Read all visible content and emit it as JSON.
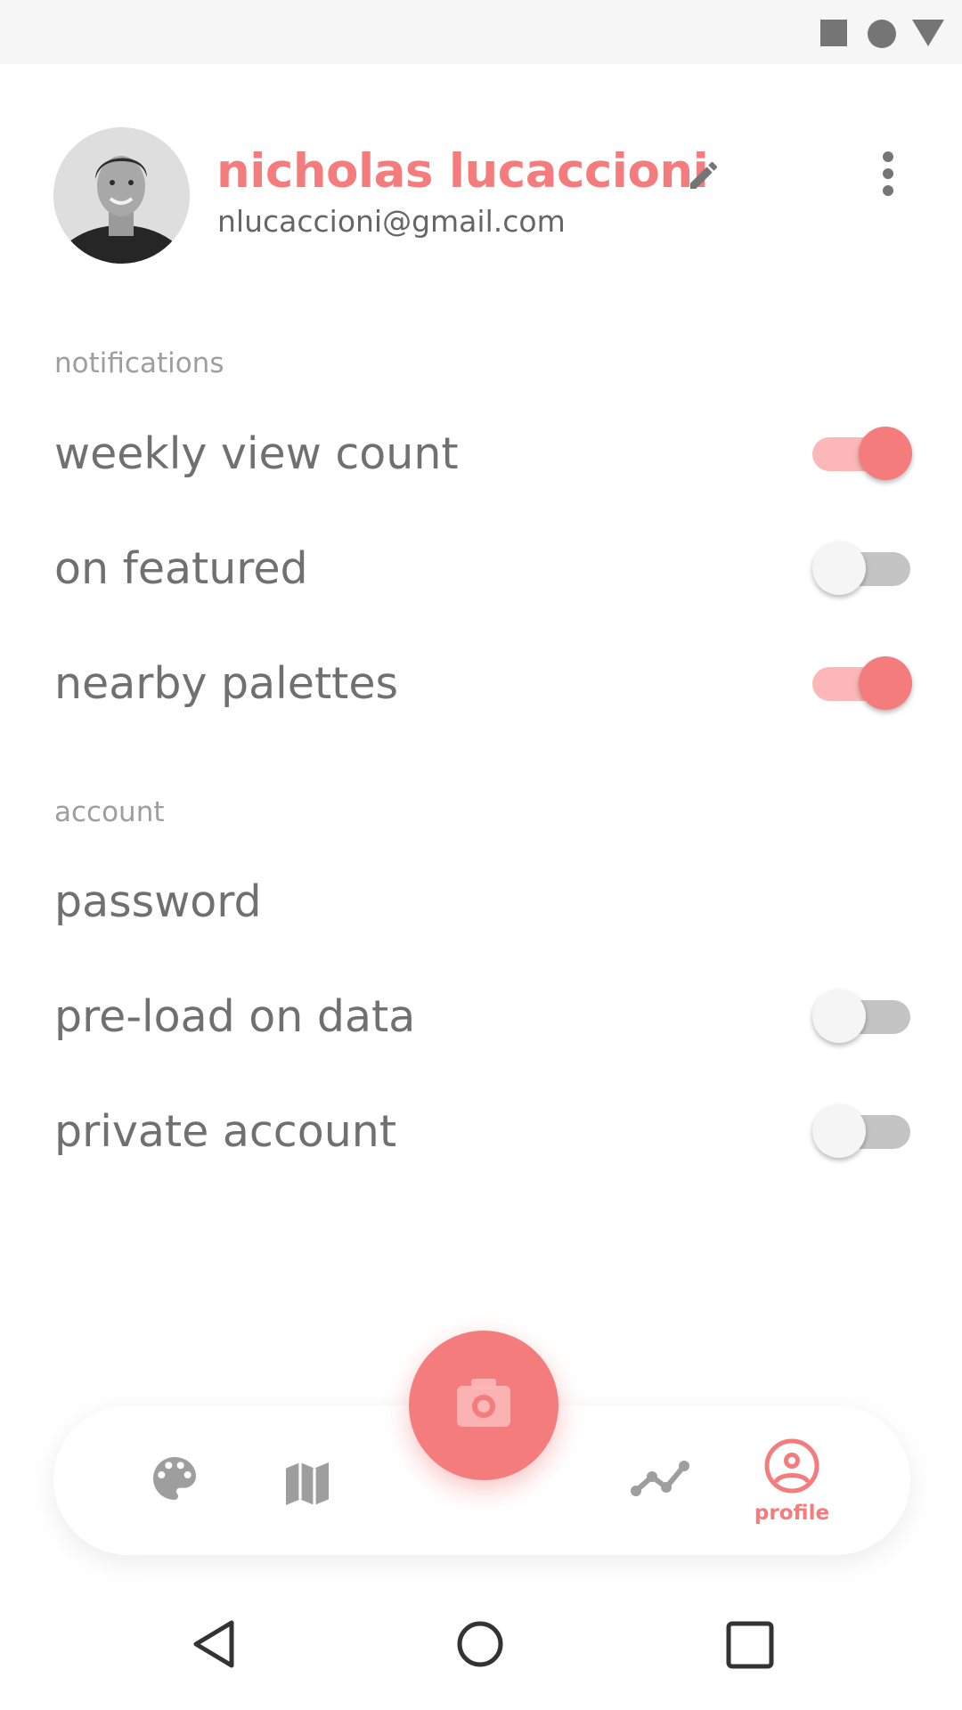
{
  "status_bar": {
    "icons": [
      "square-icon",
      "circle-icon",
      "triangle-icon"
    ]
  },
  "profile": {
    "name": "nicholas lucaccioni",
    "email": "nlucaccioni@gmail.com"
  },
  "notifications": {
    "header": "notifications",
    "items": [
      {
        "label": "weekly view count",
        "enabled": true
      },
      {
        "label": "on featured",
        "enabled": false
      },
      {
        "label": "nearby palettes",
        "enabled": true
      }
    ]
  },
  "account": {
    "header": "account",
    "items": [
      {
        "label": "password"
      },
      {
        "label": "pre-load on data",
        "enabled": false
      },
      {
        "label": "private account",
        "enabled": false
      }
    ]
  },
  "bottom_nav": {
    "items": [
      "palette-icon",
      "map-icon",
      "camera-icon",
      "trend-icon",
      "profile-icon"
    ],
    "active": "profile",
    "profile_label": "profile"
  },
  "colors": {
    "accent": "#f47c7c",
    "accent_light": "#fcb8b8",
    "text": "#707070",
    "subtle": "#9e9e9e",
    "toggle_off_track": "#c4c4c4",
    "icon_gray": "#9e9e9e"
  }
}
